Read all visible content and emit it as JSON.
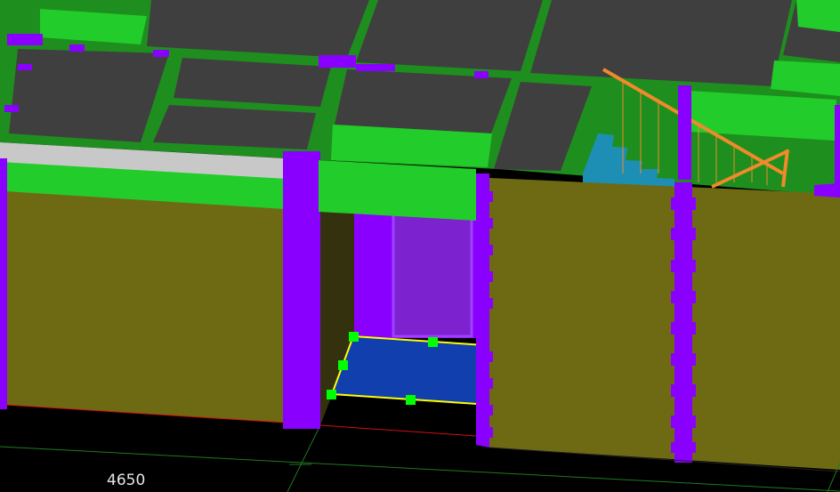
{
  "viewport": {
    "dimension_label": "4650",
    "selected_element": "floor-slab"
  },
  "colors": {
    "background": "#000000",
    "roof_slab": "#3f3f3f",
    "beam_green": "#1e8f1e",
    "beam_bright": "#22cc2a",
    "column_purple": "#8a00ff",
    "wall_olive": "#6e6a14",
    "door_purple": "#7d22cf",
    "floor_blue": "#123fae",
    "selection_outline": "#ffff00",
    "grip_green": "#00ff00",
    "stair_teal": "#1e8fb4",
    "railing_orange": "#f08a2a",
    "grid_line_green": "#1f7a1f",
    "axis_red": "#d01010",
    "parapet_grey": "#c8c8c8"
  },
  "icons": [
    "grip-square"
  ]
}
